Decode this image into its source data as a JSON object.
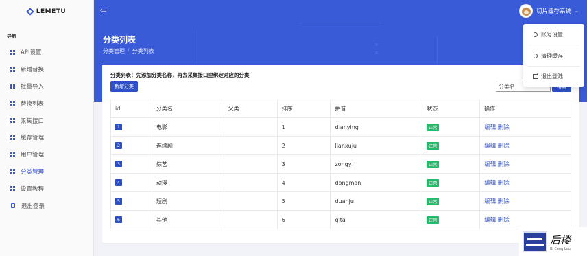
{
  "app": {
    "logo_text": "LEMETU"
  },
  "sidebar": {
    "section_title": "导航",
    "items": [
      {
        "label": "API设置"
      },
      {
        "label": "新增替换"
      },
      {
        "label": "批量导入"
      },
      {
        "label": "替换列表"
      },
      {
        "label": "采集接口"
      },
      {
        "label": "缓存管理"
      },
      {
        "label": "用户管理"
      },
      {
        "label": "分类管理",
        "active": true
      },
      {
        "label": "设置教程"
      },
      {
        "label": "退出登录"
      }
    ]
  },
  "header": {
    "username": "切片缓存系统",
    "dropdown": [
      {
        "label": "账号设置"
      },
      {
        "label": "清理缓存"
      },
      {
        "label": "退出登陆"
      }
    ]
  },
  "page": {
    "title": "分类列表",
    "breadcrumb": [
      "分类管理",
      "分类列表"
    ],
    "description": "分类列表：先添加分类名称，再去采集接口里绑定对应的分类",
    "add_button": "新增分类",
    "search_value": "分类名",
    "search_button": "搜索"
  },
  "table": {
    "headers": [
      "id",
      "分类名",
      "父类",
      "排序",
      "拼音",
      "状态",
      "操作"
    ],
    "rows": [
      {
        "id": "1",
        "name": "电影",
        "parent": "",
        "sort": "1",
        "pinyin": "dianying",
        "status": "正常",
        "edit": "编辑",
        "delete": "删除"
      },
      {
        "id": "2",
        "name": "连续剧",
        "parent": "",
        "sort": "2",
        "pinyin": "lianxuju",
        "status": "正常",
        "edit": "编辑",
        "delete": "删除"
      },
      {
        "id": "3",
        "name": "综艺",
        "parent": "",
        "sort": "3",
        "pinyin": "zongyi",
        "status": "正常",
        "edit": "编辑",
        "delete": "删除"
      },
      {
        "id": "4",
        "name": "动漫",
        "parent": "",
        "sort": "4",
        "pinyin": "dongman",
        "status": "正常",
        "edit": "编辑",
        "delete": "删除"
      },
      {
        "id": "5",
        "name": "短剧",
        "parent": "",
        "sort": "5",
        "pinyin": "duanju",
        "status": "正常",
        "edit": "编辑",
        "delete": "删除"
      },
      {
        "id": "6",
        "name": "其他",
        "parent": "",
        "sort": "6",
        "pinyin": "qita",
        "status": "正常",
        "edit": "编辑",
        "delete": "删除"
      }
    ]
  },
  "watermark": {
    "main": "后楼",
    "sub": "Bi Ceng Lou"
  },
  "colors": {
    "primary": "#3a5bd8",
    "button": "#2f50c9",
    "status_ok": "#22bb6a",
    "link": "#3a59d1"
  }
}
